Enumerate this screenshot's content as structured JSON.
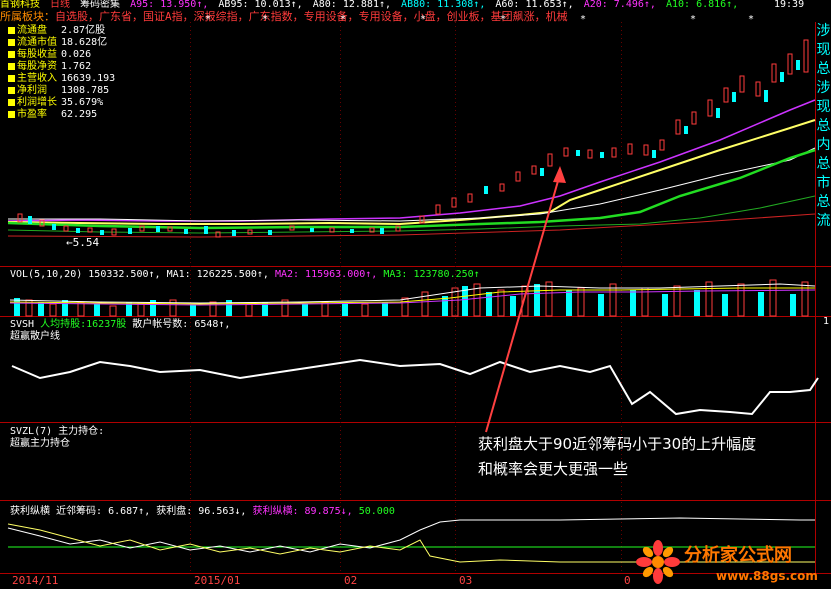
{
  "top_bar": {
    "stock": "首钢科技",
    "period": "日线",
    "tool": "筹码密集",
    "a95": "A95: 13.950↑,",
    "ab95": "AB95: 10.013↑,",
    "a80": "A80: 12.881↑,",
    "ab80": "AB80: 11.308↑,",
    "a60": "A60: 11.653↑,",
    "a20": "A20: 7.496↑,",
    "a10": "A10: 6.816↑,",
    "time": "19:39"
  },
  "sector": {
    "label": "所属板块：",
    "text": "自选股，广东省，国证A指，深报综指，广东指数，专用设备，专用设备，小盘，创业板，基团飙涨，机械"
  },
  "info_panel": [
    {
      "label": "流通盘",
      "value": "2.87亿股"
    },
    {
      "label": "流通市值",
      "value": "18.628亿"
    },
    {
      "label": "每股收益",
      "value": "0.026"
    },
    {
      "label": "每股净资",
      "value": "1.762"
    },
    {
      "label": "主营收入",
      "value": "16639.193"
    },
    {
      "label": "净利润",
      "value": "1308.785"
    },
    {
      "label": "利润增长",
      "value": "35.679%"
    },
    {
      "label": "市盈率",
      "value": "62.295"
    }
  ],
  "price_panel": {
    "low_marker": "←5.54"
  },
  "right_strip": [
    "涉",
    "现",
    "总",
    "涉",
    "现",
    "总",
    "内",
    "总",
    "市",
    "总",
    "流"
  ],
  "vol_panel": {
    "name": "VOL(5,10,20)",
    "vol": "150332.500↑,",
    "ma1": "MA1: 126225.500↑,",
    "ma2": "MA2: 115963.000↑,",
    "ma3": "MA3: 123780.250↑",
    "right_tick": "1"
  },
  "svsh_panel": {
    "name": "SVSH",
    "holder_label": "人均持股:16237股",
    "account_label": "散户帐号数: 6548↑,",
    "sub_label": "超赢散户线"
  },
  "svzl_panel": {
    "name": "SVZL(7)",
    "main_label": "主力持仓:",
    "sub_label": "超赢主力持仓"
  },
  "profit_panel": {
    "name": "获利纵横",
    "near": "近邻筹码: 6.687↑,",
    "profit": "获利盘: 96.563↓,",
    "cross": "获利纵横: 89.875↓,",
    "level": "50.000"
  },
  "annotation": {
    "line1": "获利盘大于90近邻筹码小于30的上升幅度",
    "line2": "和概率会更大更强一些"
  },
  "x_axis": [
    "2014/11",
    "2015/01",
    "02",
    "03",
    "0"
  ],
  "watermark": {
    "title": "分析家公式网",
    "url": "www.88gs.com"
  },
  "colors": {
    "up": "#ff3b3b",
    "down": "#00ffff",
    "ma_yellow": "#ffff66",
    "ma_green": "#22dd22",
    "ma_magenta": "#cc33ff"
  }
}
